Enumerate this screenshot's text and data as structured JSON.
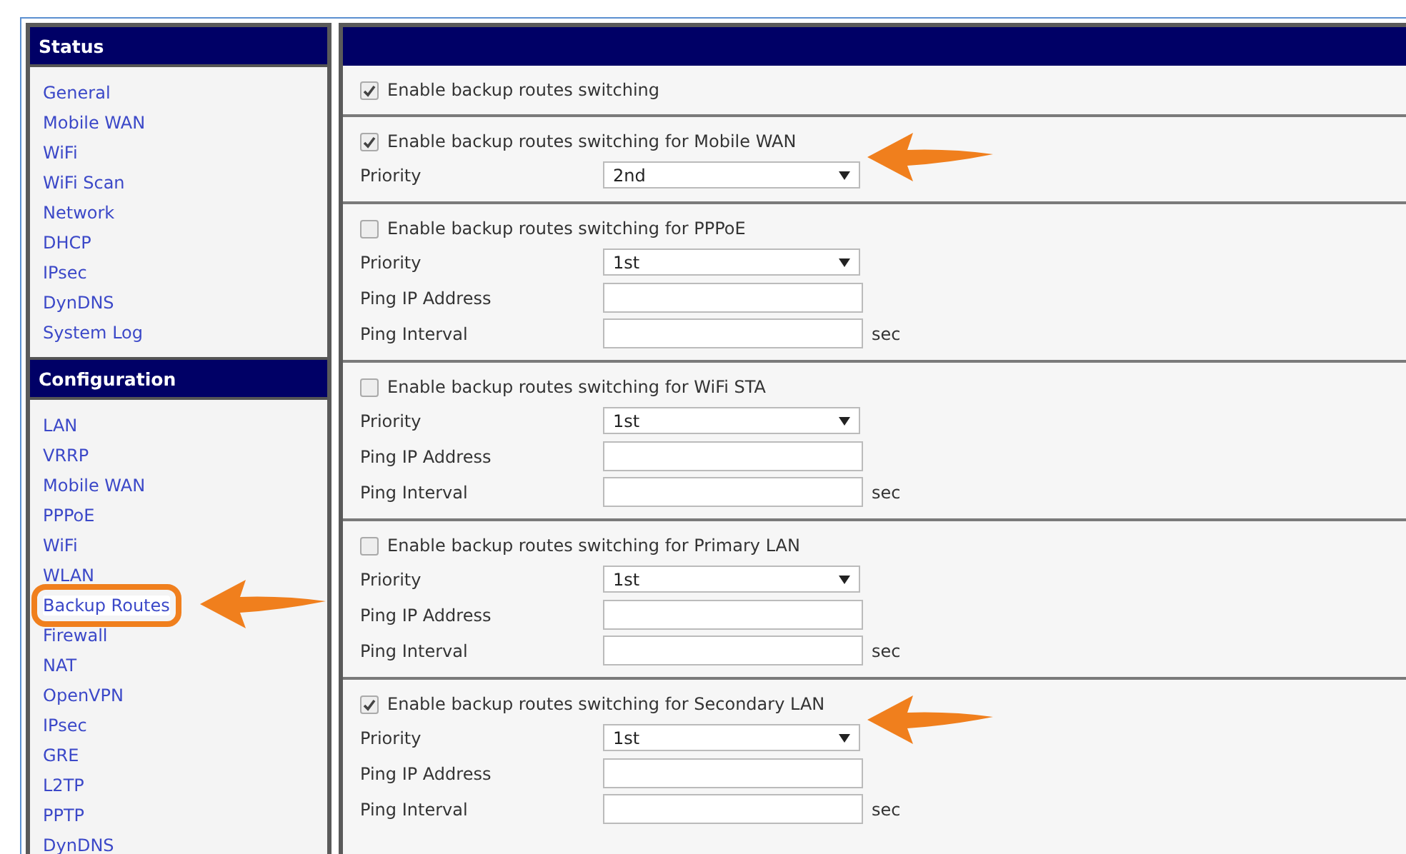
{
  "sidebar": {
    "groups": [
      {
        "title": "Status",
        "items": [
          {
            "label": "General",
            "highlighted": false
          },
          {
            "label": "Mobile WAN",
            "highlighted": false
          },
          {
            "label": "WiFi",
            "highlighted": false
          },
          {
            "label": "WiFi Scan",
            "highlighted": false
          },
          {
            "label": "Network",
            "highlighted": false
          },
          {
            "label": "DHCP",
            "highlighted": false
          },
          {
            "label": "IPsec",
            "highlighted": false
          },
          {
            "label": "DynDNS",
            "highlighted": false
          },
          {
            "label": "System Log",
            "highlighted": false
          }
        ]
      },
      {
        "title": "Configuration",
        "items": [
          {
            "label": "LAN",
            "highlighted": false
          },
          {
            "label": "VRRP",
            "highlighted": false
          },
          {
            "label": "Mobile WAN",
            "highlighted": false
          },
          {
            "label": "PPPoE",
            "highlighted": false
          },
          {
            "label": "WiFi",
            "highlighted": false
          },
          {
            "label": "WLAN",
            "highlighted": false
          },
          {
            "label": "Backup Routes",
            "highlighted": true
          },
          {
            "label": "Firewall",
            "highlighted": false
          },
          {
            "label": "NAT",
            "highlighted": false
          },
          {
            "label": "OpenVPN",
            "highlighted": false
          },
          {
            "label": "IPsec",
            "highlighted": false
          },
          {
            "label": "GRE",
            "highlighted": false
          },
          {
            "label": "L2TP",
            "highlighted": false
          },
          {
            "label": "PPTP",
            "highlighted": false
          },
          {
            "label": "DynDNS",
            "highlighted": false
          }
        ]
      }
    ]
  },
  "main": {
    "global_option": {
      "label": "Enable backup routes switching",
      "checked": true
    },
    "sections": [
      {
        "title": "Enable backup routes switching for Mobile WAN",
        "checked": true,
        "pointed": true,
        "fields": [
          {
            "kind": "select",
            "label": "Priority",
            "value": "2nd"
          }
        ]
      },
      {
        "title": "Enable backup routes switching for PPPoE",
        "checked": false,
        "pointed": false,
        "fields": [
          {
            "kind": "select",
            "label": "Priority",
            "value": "1st"
          },
          {
            "kind": "text",
            "label": "Ping IP Address"
          },
          {
            "kind": "text",
            "label": "Ping Interval",
            "unit": "sec"
          }
        ]
      },
      {
        "title": "Enable backup routes switching for WiFi STA",
        "checked": false,
        "pointed": false,
        "fields": [
          {
            "kind": "select",
            "label": "Priority",
            "value": "1st"
          },
          {
            "kind": "text",
            "label": "Ping IP Address"
          },
          {
            "kind": "text",
            "label": "Ping Interval",
            "unit": "sec"
          }
        ]
      },
      {
        "title": "Enable backup routes switching for Primary LAN",
        "checked": false,
        "pointed": false,
        "fields": [
          {
            "kind": "select",
            "label": "Priority",
            "value": "1st"
          },
          {
            "kind": "text",
            "label": "Ping IP Address"
          },
          {
            "kind": "text",
            "label": "Ping Interval",
            "unit": "sec"
          }
        ]
      },
      {
        "title": "Enable backup routes switching for Secondary LAN",
        "checked": true,
        "pointed": true,
        "fields": [
          {
            "kind": "select",
            "label": "Priority",
            "value": "1st"
          },
          {
            "kind": "text",
            "label": "Ping IP Address"
          },
          {
            "kind": "text",
            "label": "Ping Interval",
            "unit": "sec"
          }
        ]
      }
    ]
  }
}
